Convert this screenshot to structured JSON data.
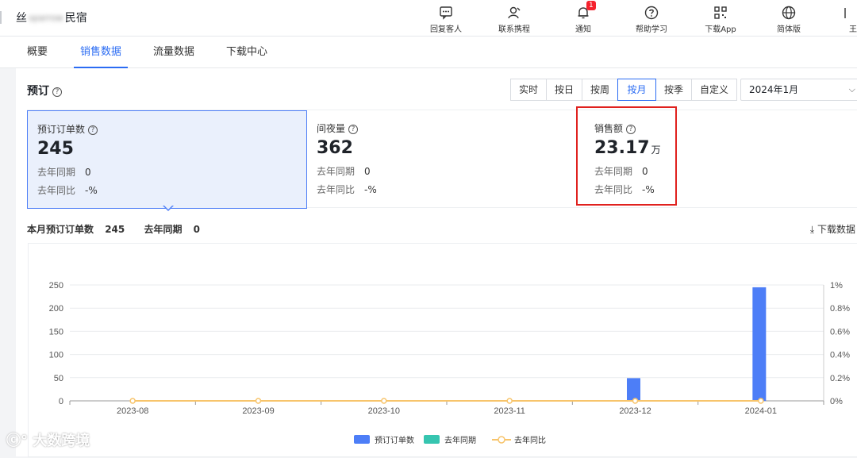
{
  "app": {
    "brand_prefix": "丝",
    "brand_blurred": "sparrow",
    "brand_suffix": "民宿"
  },
  "nav": [
    {
      "label": "回复客人",
      "icon": "chat-icon"
    },
    {
      "label": "联系携程",
      "icon": "contact-icon"
    },
    {
      "label": "通知",
      "icon": "bell-icon",
      "badge": "1"
    },
    {
      "label": "帮助学习",
      "icon": "help-icon"
    },
    {
      "label": "下载App",
      "icon": "qr-icon"
    },
    {
      "label": "简体版",
      "icon": "globe-icon"
    },
    {
      "label": "王",
      "icon": "user-icon"
    }
  ],
  "tabs": [
    "概要",
    "销售数据",
    "流量数据",
    "下载中心"
  ],
  "section": {
    "title": "预订",
    "segments": [
      "实时",
      "按日",
      "按周",
      "按月",
      "按季",
      "自定义"
    ],
    "active_segment": "按月",
    "date_value": "2024年1月"
  },
  "metrics": [
    {
      "label": "预订订单数",
      "value": "245",
      "unit": "",
      "yoy_label": "去年同期",
      "yoy_value": "0",
      "ratio_label": "去年同比",
      "ratio_value": "-%"
    },
    {
      "label": "间夜量",
      "value": "362",
      "unit": "",
      "yoy_label": "去年同期",
      "yoy_value": "0",
      "ratio_label": "去年同比",
      "ratio_value": "-%"
    },
    {
      "label": "销售额",
      "value": "23.17",
      "unit": "万",
      "yoy_label": "去年同期",
      "yoy_value": "0",
      "ratio_label": "去年同比",
      "ratio_value": "-%"
    }
  ],
  "summary": {
    "month_label": "本月预订订单数",
    "month_value": "245",
    "last_year_label": "去年同期",
    "last_year_value": "0",
    "download_label": "下载数据"
  },
  "colors": {
    "accent": "#2b6cf3",
    "bar": "#4d7ef7",
    "teal": "#36c5b0",
    "orange": "#f7c46b",
    "highlight": "#e0211e"
  },
  "chart_data": {
    "type": "bar",
    "categories": [
      "2023-08",
      "2023-09",
      "2023-10",
      "2023-11",
      "2023-12",
      "2024-01"
    ],
    "series": [
      {
        "name": "预订订单数",
        "kind": "bar",
        "values": [
          0,
          0,
          0,
          0,
          49,
          245
        ]
      },
      {
        "name": "去年同期",
        "kind": "bar",
        "values": [
          0,
          0,
          0,
          0,
          0,
          0
        ]
      },
      {
        "name": "去年同比",
        "kind": "line",
        "axis": "right",
        "values": [
          0,
          0,
          0,
          0,
          0,
          0
        ]
      }
    ],
    "y_ticks": [
      "0",
      "50",
      "100",
      "150",
      "200",
      "250"
    ],
    "y2_ticks": [
      "0%",
      "0.2%",
      "0.4%",
      "0.6%",
      "0.8%",
      "1%"
    ],
    "ylim": [
      0,
      250
    ],
    "y2lim": [
      0,
      1
    ],
    "grid": true,
    "legend_position": "bottom"
  },
  "watermark": "大数跨境"
}
